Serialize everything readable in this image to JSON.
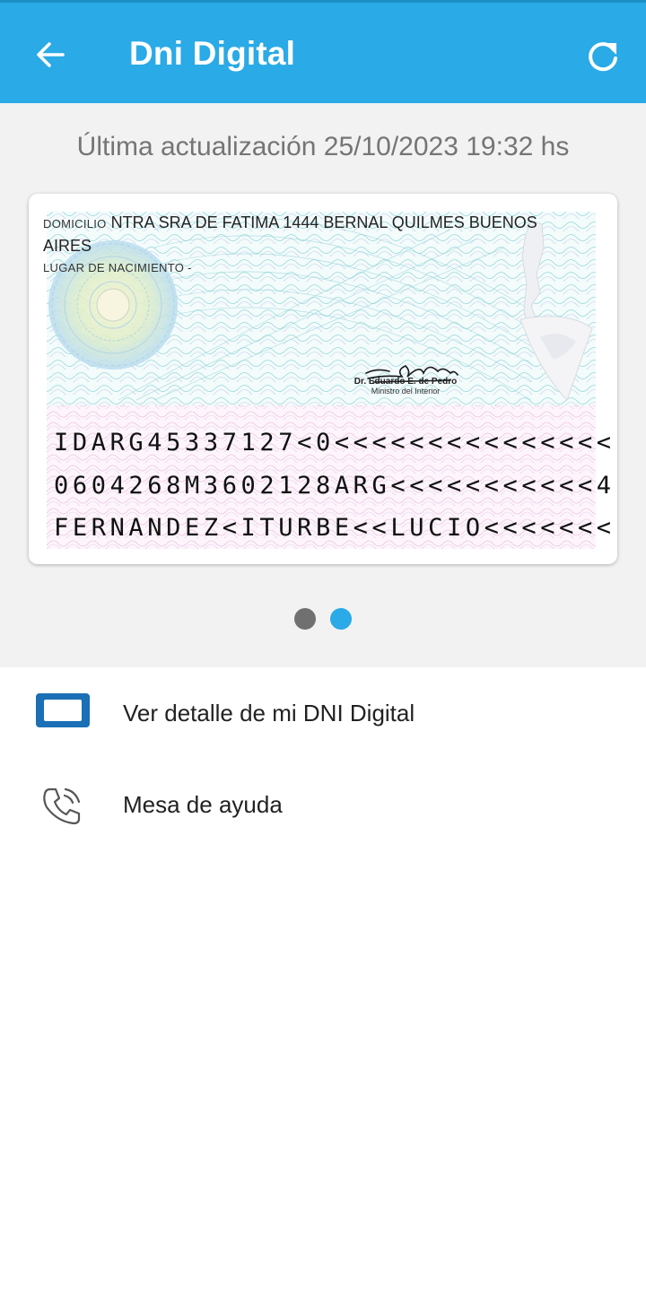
{
  "app_bar": {
    "title": "Dni Digital",
    "back_icon": "arrow-left-icon",
    "refresh_icon": "refresh-icon",
    "color": "#2aaae6"
  },
  "last_update": "Última actualización 25/10/2023 19:32 hs",
  "card": {
    "address_label": "DOMICILIO",
    "address_value": "NTRA SRA DE FATIMA 1444 BERNAL QUILMES BUENOS AIRES",
    "birthplace": "LUGAR DE NACIMIENTO -",
    "signature_script": "EdePedro",
    "signature_name": "Dr. Eduardo E. de Pedro",
    "signature_title": "Ministro del Interior",
    "mrz": [
      "IDARG45337127<0<<<<<<<<<<<<<<<",
      "0604268M3602128ARG<<<<<<<<<<<4",
      "FERNANDEZ<ITURBE<<LUCIO<<<<<<<"
    ]
  },
  "carousel": {
    "pages": 2,
    "active_index": 1,
    "inactive_color": "#707070",
    "active_color": "#2aaae6"
  },
  "menu": [
    {
      "label": "Ver detalle de mi DNI Digital",
      "icon": "id-card-icon"
    },
    {
      "label": "Mesa de ayuda",
      "icon": "phone-icon"
    }
  ]
}
